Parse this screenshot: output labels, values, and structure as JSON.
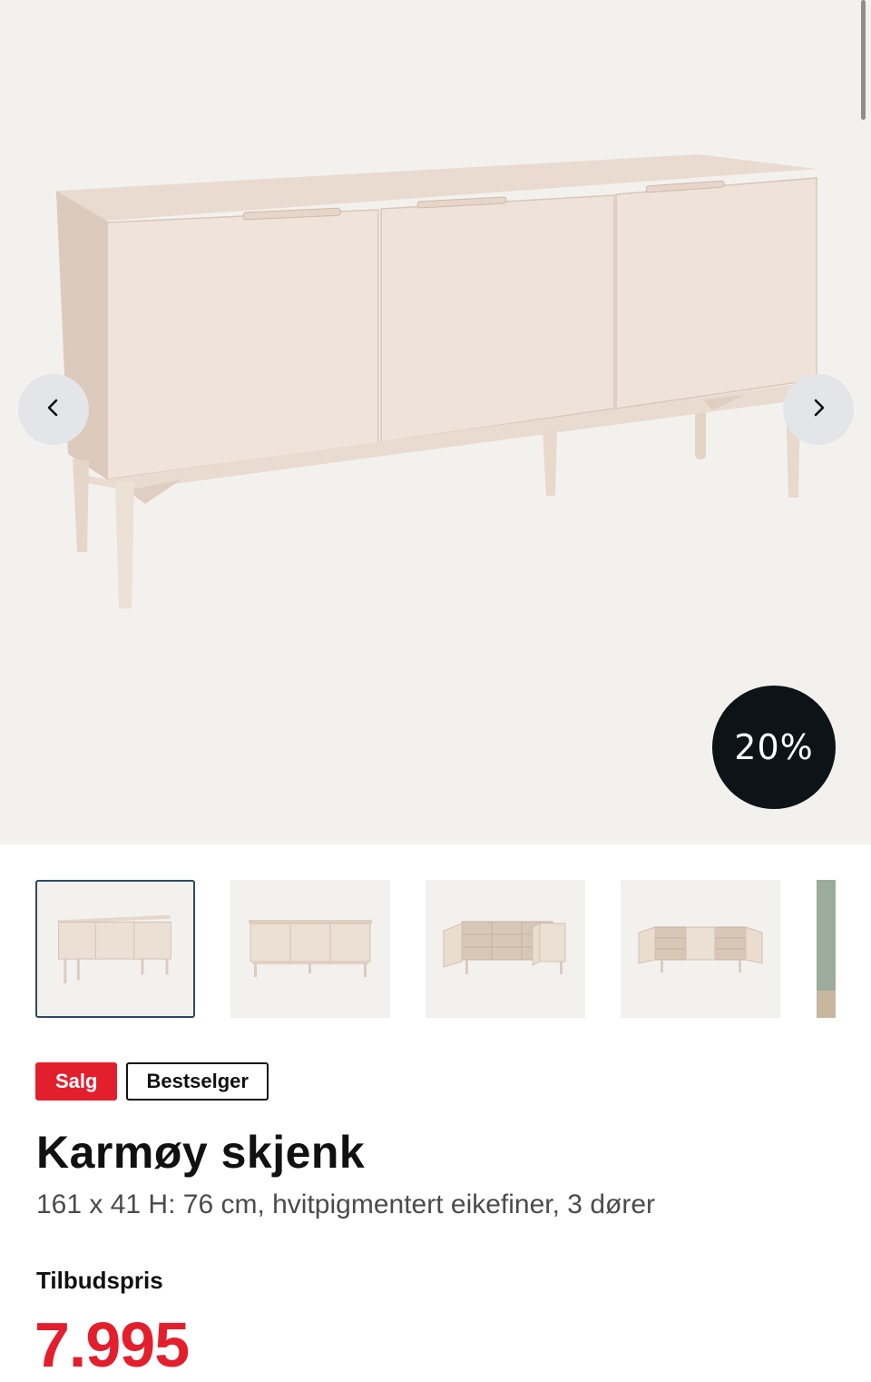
{
  "gallery": {
    "image_alt": "Karmøy skjenk",
    "discount_badge": "20%",
    "prev_icon": "chevron-left-icon",
    "next_icon": "chevron-right-icon",
    "thumbnails": [
      {
        "view": "front-angle",
        "selected": true
      },
      {
        "view": "front",
        "selected": false
      },
      {
        "view": "open-doors-left",
        "selected": false
      },
      {
        "view": "open-doors-both",
        "selected": false
      },
      {
        "view": "room-setting",
        "selected": false
      }
    ]
  },
  "badges": {
    "sale": "Salg",
    "bestseller": "Bestselger"
  },
  "product": {
    "title": "Karmøy skjenk",
    "subtitle": "161 x 41 H: 76 cm, hvitpigmentert eikefiner, 3 dører",
    "price_label": "Tilbudspris",
    "price": "7.995"
  },
  "colors": {
    "sale_red": "#e41f2d",
    "badge_dark": "#0d1417",
    "hero_bg": "#f3f1ee",
    "active_border": "#2d4a63"
  }
}
